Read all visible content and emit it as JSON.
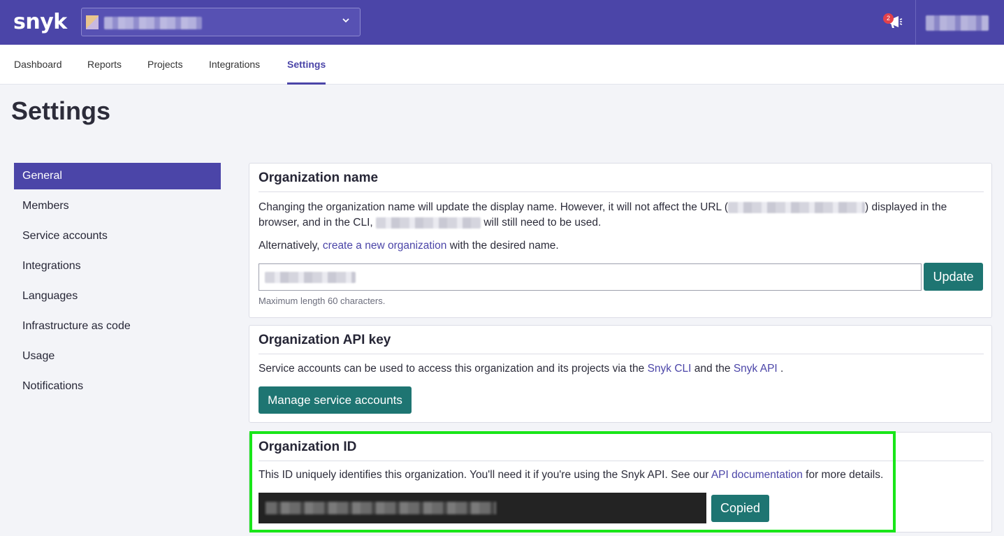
{
  "brand": {
    "logo_text": "snyk",
    "primary_color": "#4b45a8",
    "button_color": "#1e7572",
    "highlight_color": "#19e619"
  },
  "header": {
    "org_select_icon": "chevron-down-icon",
    "notification_count": "2",
    "notification_icon": "megaphone-icon"
  },
  "nav": {
    "tabs": [
      {
        "label": "Dashboard"
      },
      {
        "label": "Reports"
      },
      {
        "label": "Projects"
      },
      {
        "label": "Integrations"
      },
      {
        "label": "Settings",
        "active": true
      }
    ]
  },
  "page": {
    "title": "Settings"
  },
  "sidebar": {
    "items": [
      {
        "label": "General",
        "active": true
      },
      {
        "label": "Members"
      },
      {
        "label": "Service accounts"
      },
      {
        "label": "Integrations"
      },
      {
        "label": "Languages"
      },
      {
        "label": "Infrastructure as code"
      },
      {
        "label": "Usage"
      },
      {
        "label": "Notifications"
      }
    ]
  },
  "org_name": {
    "title": "Organization name",
    "desc_a": "Changing the organization name will update the display name. However, it will not affect the URL (",
    "desc_b": ") displayed in the",
    "desc_c": "browser, and in the CLI,",
    "desc_d": "will still need to be used.",
    "alt_prefix": "Alternatively,",
    "alt_link": "create a new organization",
    "alt_suffix": "with the desired name.",
    "update_label": "Update",
    "hint": "Maximum length 60 characters."
  },
  "api_key": {
    "title": "Organization API key",
    "desc_prefix": "Service accounts can be used to access this organization and its projects via the",
    "cli_link": "Snyk CLI",
    "desc_mid": "and the",
    "api_link": "Snyk API",
    "desc_suffix": ".",
    "manage_label": "Manage service accounts"
  },
  "org_id": {
    "title": "Organization ID",
    "desc_prefix": "This ID uniquely identifies this organization. You'll need it if you're using the Snyk API. See our",
    "docs_link": "API documentation",
    "desc_suffix": "for more details.",
    "copied_label": "Copied"
  }
}
